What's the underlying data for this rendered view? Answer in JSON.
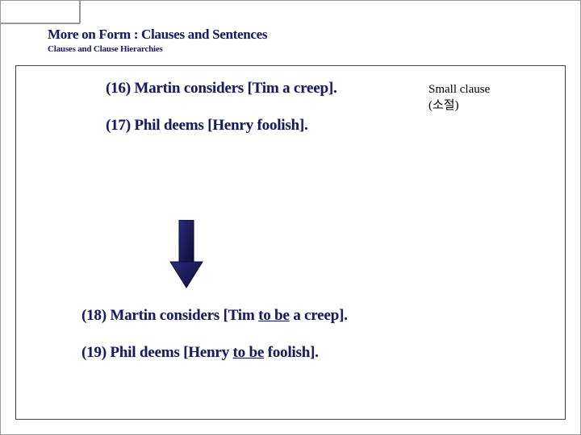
{
  "header": {
    "title": "More on Form : Clauses and Sentences",
    "subtitle": "Clauses and Clause Hierarchies"
  },
  "examples_top": {
    "e16": "(16) Martin considers [Tim a creep].",
    "e17": "(17) Phil deems [Henry foolish]."
  },
  "annotation": {
    "line1": "Small clause",
    "line2": " (소절)"
  },
  "examples_bottom": {
    "e18_pre": "(18) Martin considers [Tim ",
    "e18_u": "to be",
    "e18_post": " a creep].",
    "e19_pre": "(19) Phil deems [Henry ",
    "e19_u": "to be",
    "e19_post": " foolish]."
  },
  "icons": {
    "arrow": "down-arrow"
  },
  "colors": {
    "text": "#1a1a5e",
    "arrow_fill": "#1a1a5e"
  }
}
